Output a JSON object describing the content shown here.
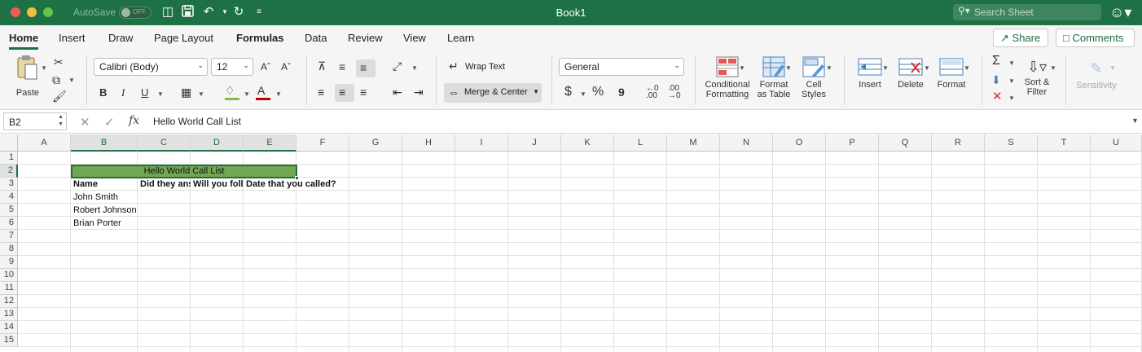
{
  "titlebar": {
    "autosave_label": "AutoSave",
    "autosave_state": "OFF",
    "document_title": "Book1",
    "search_placeholder": "Search Sheet"
  },
  "ribbon_tabs": [
    "Home",
    "Insert",
    "Draw",
    "Page Layout",
    "Formulas",
    "Data",
    "Review",
    "View",
    "Learn"
  ],
  "active_tab": "Home",
  "share_label": "Share",
  "comments_label": "Comments",
  "ribbon": {
    "paste_label": "Paste",
    "font_name": "Calibri (Body)",
    "font_size": "12",
    "bold": "B",
    "italic": "I",
    "underline": "U",
    "wrap_text": "Wrap Text",
    "merge_center": "Merge & Center",
    "number_format": "General",
    "currency": "$",
    "percent": "%",
    "comma": "9",
    "conditional_formatting": [
      "Conditional",
      "Formatting"
    ],
    "format_as_table": [
      "Format",
      "as Table"
    ],
    "cell_styles": [
      "Cell",
      "Styles"
    ],
    "insert": "Insert",
    "delete": "Delete",
    "format": "Format",
    "sort_filter": [
      "Sort &",
      "Filter"
    ],
    "sensitivity": "Sensitivity"
  },
  "formula_bar": {
    "name_box": "B2",
    "fx": "fx",
    "formula": "Hello World Call List"
  },
  "grid": {
    "columns": [
      "A",
      "B",
      "C",
      "D",
      "E",
      "F",
      "G",
      "H",
      "I",
      "J",
      "K",
      "L",
      "M",
      "N",
      "O",
      "P",
      "Q",
      "R",
      "S",
      "T",
      "U"
    ],
    "rows": [
      "1",
      "2",
      "3",
      "4",
      "5",
      "6",
      "7",
      "8",
      "9",
      "10",
      "11",
      "12",
      "13",
      "14",
      "15"
    ],
    "selected_cell": "B2",
    "merged_title": "Hello World Call List",
    "headers": {
      "B3": "Name",
      "C3": "Did they ans",
      "D3": "Will you folle",
      "E3": "Date that you called?"
    },
    "names": [
      "John Smith",
      "Robert Johnson",
      "Brian Porter"
    ]
  },
  "colors": {
    "title_bar": "#1e7145",
    "merged_fill": "#71a652",
    "accent": "#1e7145"
  }
}
